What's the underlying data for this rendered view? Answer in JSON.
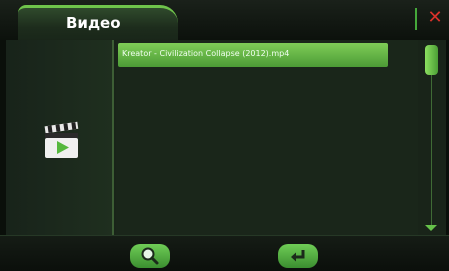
{
  "header": {
    "tab_label": "Видео",
    "close_icon": "close-icon",
    "accent": "#6fc44b",
    "close_color": "#d9322a"
  },
  "left_panel": {
    "icon": "video-clapper-icon"
  },
  "file_list": {
    "items": [
      {
        "label": "Kreator - Civilization Collapse (2012).mp4",
        "selected": true
      }
    ]
  },
  "scrollbar": {
    "thumb_icon": "scroll-thumb",
    "down_icon": "scroll-down-arrow-icon"
  },
  "footer": {
    "buttons": [
      {
        "icon": "search-zoom-icon"
      },
      {
        "icon": "enter-return-icon"
      }
    ]
  }
}
